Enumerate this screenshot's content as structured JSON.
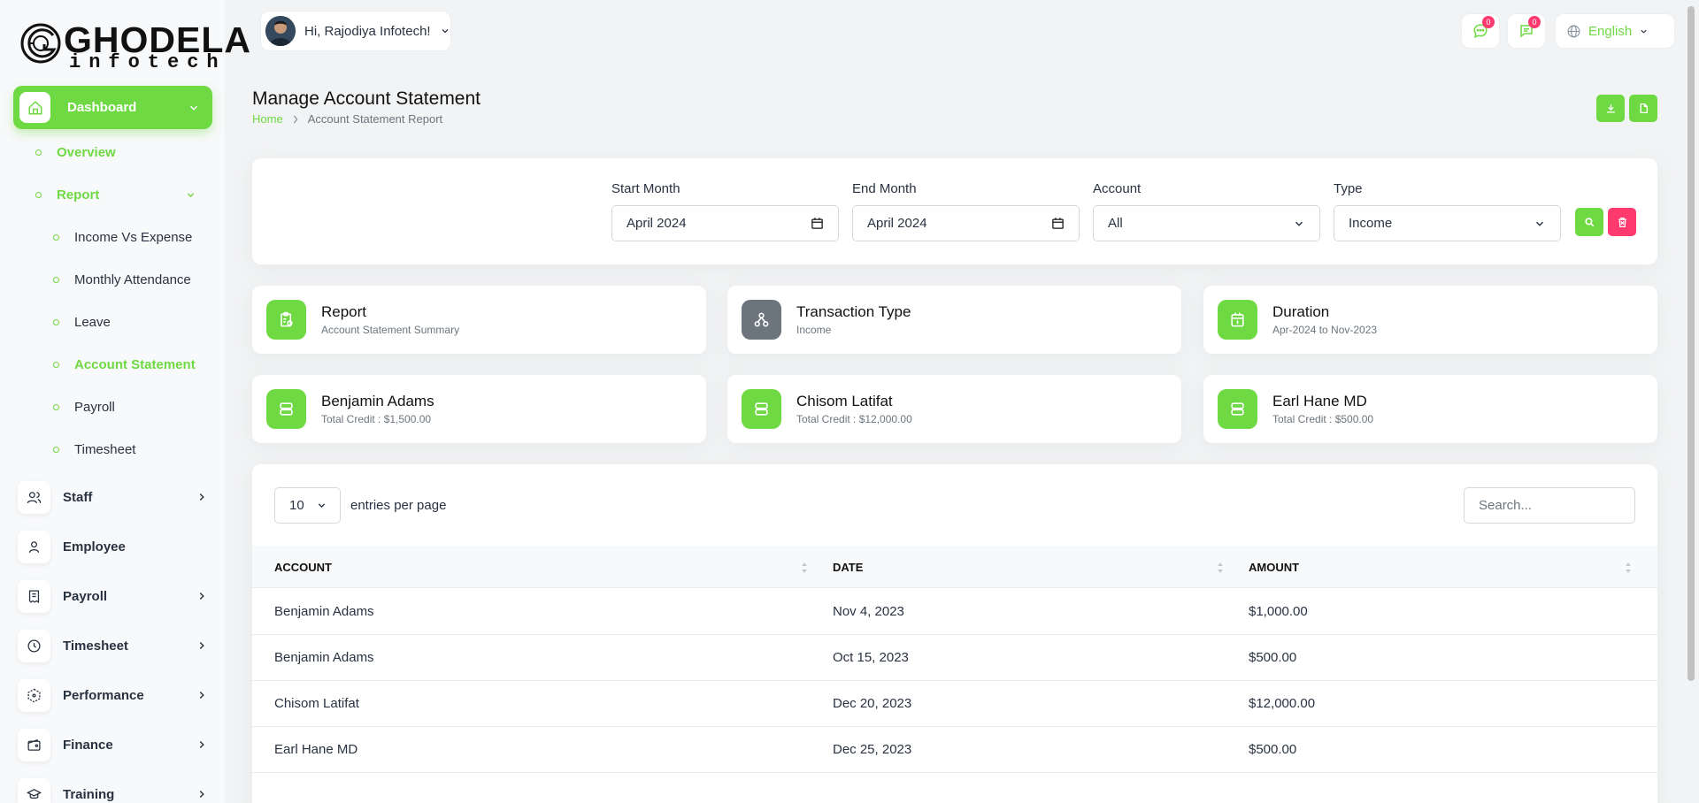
{
  "brand": {
    "name_1": "GHODELA",
    "name_2": "infotech"
  },
  "sidebar": {
    "dashboard": {
      "label": "Dashboard"
    },
    "sub": {
      "overview": "Overview",
      "report": "Report",
      "income_vs_expense": "Income Vs Expense",
      "monthly_attendance": "Monthly Attendance",
      "leave": "Leave",
      "account_statement": "Account Statement",
      "payroll": "Payroll",
      "timesheet": "Timesheet"
    },
    "items": {
      "staff": "Staff",
      "employee": "Employee",
      "payroll": "Payroll",
      "timesheet": "Timesheet",
      "performance": "Performance",
      "finance": "Finance",
      "training": "Training"
    }
  },
  "header": {
    "greeting": "Hi, Rajodiya Infotech!",
    "notif_count_1": "0",
    "notif_count_2": "0",
    "language": "English"
  },
  "page": {
    "title": "Manage Account Statement",
    "breadcrumb_home": "Home",
    "breadcrumb_current": "Account Statement Report"
  },
  "filters": {
    "start_label": "Start Month",
    "start_value": "April 2024",
    "end_label": "End Month",
    "end_value": "April 2024",
    "account_label": "Account",
    "account_value": "All",
    "type_label": "Type",
    "type_value": "Income"
  },
  "info": [
    {
      "title": "Report",
      "subtitle": "Account Statement Summary"
    },
    {
      "title": "Transaction Type",
      "subtitle": "Income"
    },
    {
      "title": "Duration",
      "subtitle": "Apr-2024 to Nov-2023"
    },
    {
      "title": "Benjamin Adams",
      "subtitle": "Total Credit : $1,500.00"
    },
    {
      "title": "Chisom Latifat",
      "subtitle": "Total Credit : $12,000.00"
    },
    {
      "title": "Earl Hane MD",
      "subtitle": "Total Credit : $500.00"
    }
  ],
  "table": {
    "per_page_value": "10",
    "per_page_label": "entries per page",
    "search_placeholder": "Search...",
    "columns": [
      "ACCOUNT",
      "DATE",
      "AMOUNT"
    ],
    "rows": [
      [
        "Benjamin Adams",
        "Nov 4, 2023",
        "$1,000.00"
      ],
      [
        "Benjamin Adams",
        "Oct 15, 2023",
        "$500.00"
      ],
      [
        "Chisom Latifat",
        "Dec 20, 2023",
        "$12,000.00"
      ],
      [
        "Earl Hane MD",
        "Dec 25, 2023",
        "$500.00"
      ]
    ]
  },
  "colors": {
    "accent": "#6fd943",
    "danger": "#ff3a6e",
    "secondary": "#6c757d"
  }
}
